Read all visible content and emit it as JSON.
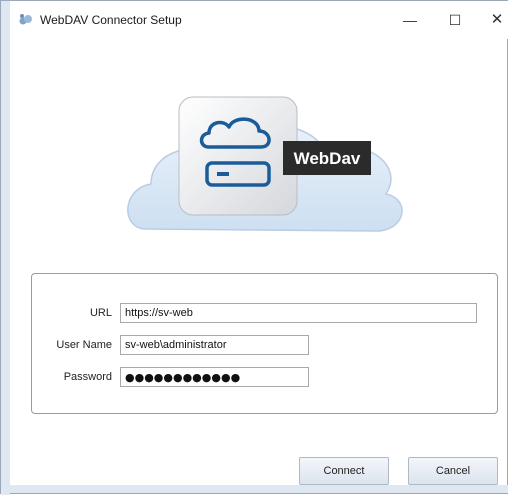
{
  "window": {
    "title": "WebDAV Connector Setup",
    "controls": {
      "minimize": "—",
      "maximize": "☐",
      "close": "✕"
    }
  },
  "hero": {
    "badge_text": "WebDav",
    "icon": "cloud-server-icon"
  },
  "form": {
    "url_label": "URL",
    "url_value": "https://sv-web",
    "username_label": "User Name",
    "username_value": "sv-web\\administrator",
    "password_label": "Password",
    "password_value": "●●●●●●●●●●●●"
  },
  "buttons": {
    "connect": "Connect",
    "cancel": "Cancel"
  },
  "colors": {
    "accent_strip": "#dfe7f2",
    "cloud_fill": "#dbe8f5",
    "badge_bg": "#2b2b2b"
  }
}
